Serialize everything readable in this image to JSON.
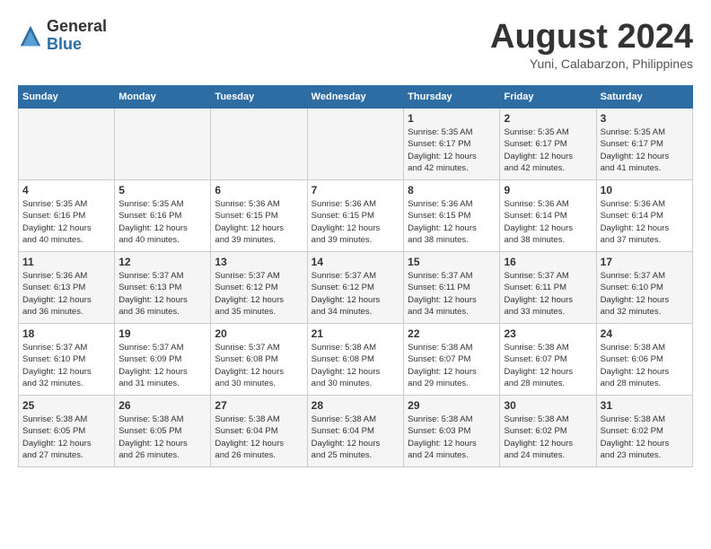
{
  "logo": {
    "general": "General",
    "blue": "Blue"
  },
  "title": {
    "month_year": "August 2024",
    "location": "Yuni, Calabarzon, Philippines"
  },
  "headers": [
    "Sunday",
    "Monday",
    "Tuesday",
    "Wednesday",
    "Thursday",
    "Friday",
    "Saturday"
  ],
  "weeks": [
    [
      {
        "day": "",
        "detail": ""
      },
      {
        "day": "",
        "detail": ""
      },
      {
        "day": "",
        "detail": ""
      },
      {
        "day": "",
        "detail": ""
      },
      {
        "day": "1",
        "detail": "Sunrise: 5:35 AM\nSunset: 6:17 PM\nDaylight: 12 hours\nand 42 minutes."
      },
      {
        "day": "2",
        "detail": "Sunrise: 5:35 AM\nSunset: 6:17 PM\nDaylight: 12 hours\nand 42 minutes."
      },
      {
        "day": "3",
        "detail": "Sunrise: 5:35 AM\nSunset: 6:17 PM\nDaylight: 12 hours\nand 41 minutes."
      }
    ],
    [
      {
        "day": "4",
        "detail": "Sunrise: 5:35 AM\nSunset: 6:16 PM\nDaylight: 12 hours\nand 40 minutes."
      },
      {
        "day": "5",
        "detail": "Sunrise: 5:35 AM\nSunset: 6:16 PM\nDaylight: 12 hours\nand 40 minutes."
      },
      {
        "day": "6",
        "detail": "Sunrise: 5:36 AM\nSunset: 6:15 PM\nDaylight: 12 hours\nand 39 minutes."
      },
      {
        "day": "7",
        "detail": "Sunrise: 5:36 AM\nSunset: 6:15 PM\nDaylight: 12 hours\nand 39 minutes."
      },
      {
        "day": "8",
        "detail": "Sunrise: 5:36 AM\nSunset: 6:15 PM\nDaylight: 12 hours\nand 38 minutes."
      },
      {
        "day": "9",
        "detail": "Sunrise: 5:36 AM\nSunset: 6:14 PM\nDaylight: 12 hours\nand 38 minutes."
      },
      {
        "day": "10",
        "detail": "Sunrise: 5:36 AM\nSunset: 6:14 PM\nDaylight: 12 hours\nand 37 minutes."
      }
    ],
    [
      {
        "day": "11",
        "detail": "Sunrise: 5:36 AM\nSunset: 6:13 PM\nDaylight: 12 hours\nand 36 minutes."
      },
      {
        "day": "12",
        "detail": "Sunrise: 5:37 AM\nSunset: 6:13 PM\nDaylight: 12 hours\nand 36 minutes."
      },
      {
        "day": "13",
        "detail": "Sunrise: 5:37 AM\nSunset: 6:12 PM\nDaylight: 12 hours\nand 35 minutes."
      },
      {
        "day": "14",
        "detail": "Sunrise: 5:37 AM\nSunset: 6:12 PM\nDaylight: 12 hours\nand 34 minutes."
      },
      {
        "day": "15",
        "detail": "Sunrise: 5:37 AM\nSunset: 6:11 PM\nDaylight: 12 hours\nand 34 minutes."
      },
      {
        "day": "16",
        "detail": "Sunrise: 5:37 AM\nSunset: 6:11 PM\nDaylight: 12 hours\nand 33 minutes."
      },
      {
        "day": "17",
        "detail": "Sunrise: 5:37 AM\nSunset: 6:10 PM\nDaylight: 12 hours\nand 32 minutes."
      }
    ],
    [
      {
        "day": "18",
        "detail": "Sunrise: 5:37 AM\nSunset: 6:10 PM\nDaylight: 12 hours\nand 32 minutes."
      },
      {
        "day": "19",
        "detail": "Sunrise: 5:37 AM\nSunset: 6:09 PM\nDaylight: 12 hours\nand 31 minutes."
      },
      {
        "day": "20",
        "detail": "Sunrise: 5:37 AM\nSunset: 6:08 PM\nDaylight: 12 hours\nand 30 minutes."
      },
      {
        "day": "21",
        "detail": "Sunrise: 5:38 AM\nSunset: 6:08 PM\nDaylight: 12 hours\nand 30 minutes."
      },
      {
        "day": "22",
        "detail": "Sunrise: 5:38 AM\nSunset: 6:07 PM\nDaylight: 12 hours\nand 29 minutes."
      },
      {
        "day": "23",
        "detail": "Sunrise: 5:38 AM\nSunset: 6:07 PM\nDaylight: 12 hours\nand 28 minutes."
      },
      {
        "day": "24",
        "detail": "Sunrise: 5:38 AM\nSunset: 6:06 PM\nDaylight: 12 hours\nand 28 minutes."
      }
    ],
    [
      {
        "day": "25",
        "detail": "Sunrise: 5:38 AM\nSunset: 6:05 PM\nDaylight: 12 hours\nand 27 minutes."
      },
      {
        "day": "26",
        "detail": "Sunrise: 5:38 AM\nSunset: 6:05 PM\nDaylight: 12 hours\nand 26 minutes."
      },
      {
        "day": "27",
        "detail": "Sunrise: 5:38 AM\nSunset: 6:04 PM\nDaylight: 12 hours\nand 26 minutes."
      },
      {
        "day": "28",
        "detail": "Sunrise: 5:38 AM\nSunset: 6:04 PM\nDaylight: 12 hours\nand 25 minutes."
      },
      {
        "day": "29",
        "detail": "Sunrise: 5:38 AM\nSunset: 6:03 PM\nDaylight: 12 hours\nand 24 minutes."
      },
      {
        "day": "30",
        "detail": "Sunrise: 5:38 AM\nSunset: 6:02 PM\nDaylight: 12 hours\nand 24 minutes."
      },
      {
        "day": "31",
        "detail": "Sunrise: 5:38 AM\nSunset: 6:02 PM\nDaylight: 12 hours\nand 23 minutes."
      }
    ]
  ]
}
